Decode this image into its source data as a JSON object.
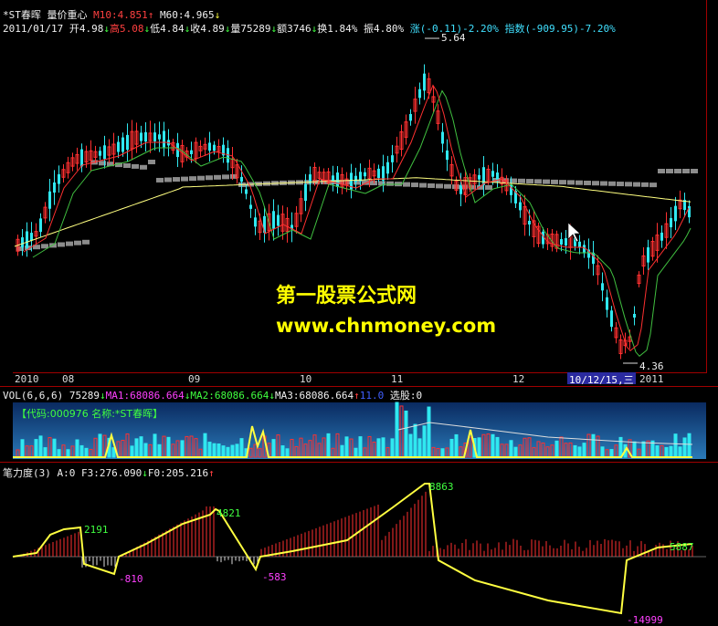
{
  "header": {
    "name": "*ST春晖",
    "indicator": "量价重心",
    "m10": "M10:4.851",
    "m10_arrow": "↑",
    "m60": "M60:4.965",
    "m60_arrow": "↓"
  },
  "quote": {
    "date": "2011/01/17",
    "open": "开4.98",
    "high": "高5.08",
    "low": "低4.84",
    "close": "收4.89",
    "volume": "量75289",
    "amount": "额3746",
    "turnover": "换1.84%",
    "amplitude": "振4.80%",
    "change": "涨(-0.11)-2.20%",
    "index": "指数(-909.95)-7.20%"
  },
  "price_labels": {
    "high": "5.64",
    "low": "4.36"
  },
  "watermark": {
    "title": "第一股票公式网",
    "url": "www.chnmoney.com"
  },
  "date_axis": {
    "ticks": [
      "2010",
      "08",
      "09",
      "10",
      "11",
      "12",
      "2011"
    ],
    "cursor_date": "10/12/15,三"
  },
  "vol_header": {
    "label": "VOL(6,6,6)",
    "value": "75289",
    "ma1": "MA1:68086.664",
    "ma2": "MA2:68086.664",
    "ma3": "MA3:68086.664",
    "extra": "11.0",
    "select": "选股:0"
  },
  "vol_info": "【代码:000976 名称:*ST春晖】",
  "bili_header": {
    "label": "笔力度(3)",
    "a": "A:0",
    "f3": "F3:276.090",
    "f0": "F0:205.216"
  },
  "bili_labels": {
    "v1": "2191",
    "v2": "-810",
    "v3": "4821",
    "v4": "-583",
    "v5": "8863",
    "v6": "-14999",
    "v7": "5887"
  },
  "colors": {
    "up": "#ff3030",
    "down": "#30e8f0",
    "ma_yellow": "#ffff80",
    "ma_green": "#40c040",
    "ma_red": "#ff3030",
    "line_yellow": "#ffff40"
  }
}
